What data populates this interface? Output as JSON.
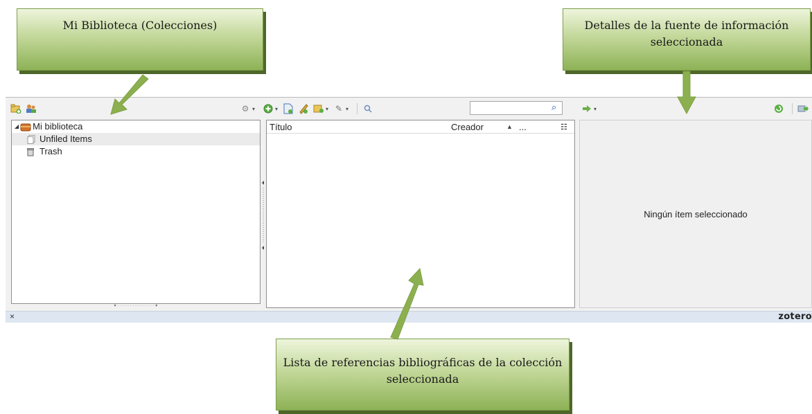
{
  "callouts": {
    "library": "Mi Biblioteca (Colecciones)",
    "details": "Detalles de la fuente de información seleccionada",
    "list": "Lista de referencias bibliográficas de la colección seleccionada"
  },
  "colors": {
    "callout_green": "#8db256",
    "arrow_green": "#8cb04f",
    "status_bar": "#dde6f1"
  },
  "toolbar": {
    "left": {
      "icons": [
        "new-collection-icon",
        "new-group-icon"
      ],
      "actions_icon": "gear-icon"
    },
    "middle": {
      "icons": [
        "new-item-icon",
        "add-by-identifier-icon",
        "new-note-icon",
        "attach-icon",
        "paperclip-icon",
        "advanced-search-icon"
      ]
    },
    "search": {
      "value": "",
      "placeholder": ""
    },
    "right": {
      "icons": [
        "locate-icon",
        "sync-icon",
        "fullscreen-icon"
      ]
    }
  },
  "collections": {
    "library_label": "Mi biblioteca",
    "items": [
      {
        "label": "Unfiled Items",
        "icon": "unfiled-icon"
      },
      {
        "label": "Trash",
        "icon": "trash-icon"
      }
    ]
  },
  "items_table": {
    "columns": {
      "title": "Título",
      "creator": "Creador",
      "more": "..."
    },
    "rows": []
  },
  "details": {
    "empty_message": "Ningún ítem seleccionado"
  },
  "status": {
    "close": "×",
    "logo": "zotero"
  }
}
